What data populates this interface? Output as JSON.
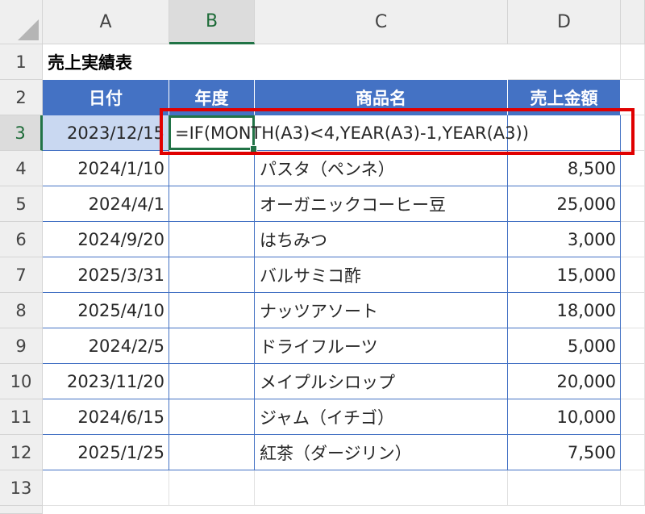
{
  "columns": [
    "A",
    "B",
    "C",
    "D"
  ],
  "rows": [
    "1",
    "2",
    "3",
    "4",
    "5",
    "6",
    "7",
    "8",
    "9",
    "10",
    "11",
    "12",
    "13"
  ],
  "title": "売上実績表",
  "table_headers": {
    "date": "日付",
    "fiscal_year": "年度",
    "product": "商品名",
    "sales": "売上金額"
  },
  "active_row": {
    "date": "2023/12/15",
    "formula": "=IF(MONTH(A3)<4,YEAR(A3)-1,YEAR(A3))"
  },
  "records": [
    {
      "date": "2024/1/10",
      "product": "パスタ（ペンネ）",
      "sales": "8,500"
    },
    {
      "date": "2024/4/1",
      "product": "オーガニックコーヒー豆",
      "sales": "25,000"
    },
    {
      "date": "2024/9/20",
      "product": "はちみつ",
      "sales": "3,000"
    },
    {
      "date": "2025/3/31",
      "product": "バルサミコ酢",
      "sales": "15,000"
    },
    {
      "date": "2025/4/10",
      "product": "ナッツアソート",
      "sales": "18,000"
    },
    {
      "date": "2024/2/5",
      "product": "ドライフルーツ",
      "sales": "5,000"
    },
    {
      "date": "2023/11/20",
      "product": "メイプルシロップ",
      "sales": "20,000"
    },
    {
      "date": "2024/6/15",
      "product": "ジャム（イチゴ）",
      "sales": "10,000"
    },
    {
      "date": "2025/1/25",
      "product": "紅茶（ダージリン）",
      "sales": "7,500"
    }
  ],
  "colors": {
    "header_fill": "#4472c4",
    "selection": "#217346",
    "highlight": "#e00000"
  }
}
